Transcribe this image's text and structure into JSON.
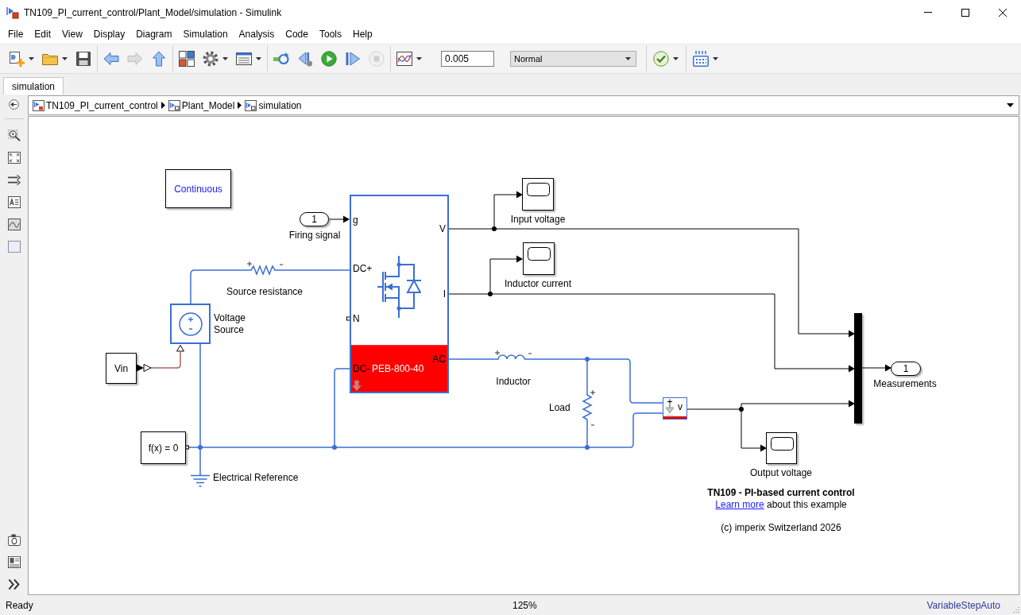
{
  "window": {
    "title": "TN109_PI_current_control/Plant_Model/simulation - Simulink"
  },
  "menu": [
    "File",
    "Edit",
    "View",
    "Display",
    "Diagram",
    "Simulation",
    "Analysis",
    "Code",
    "Tools",
    "Help"
  ],
  "toolbar": {
    "left_groups": [
      [
        {
          "dropdown": true,
          "disabled": false
        },
        {
          "dropdown": true,
          "disabled": false
        },
        {
          "dropdown": false,
          "disabled": false
        }
      ],
      [
        {
          "dropdown": false,
          "disabled": false
        },
        {
          "dropdown": false,
          "disabled": true
        },
        {
          "dropdown": false,
          "disabled": false
        }
      ],
      [
        {
          "dropdown": false,
          "disabled": false
        },
        {
          "dropdown": true,
          "disabled": false
        },
        {
          "dropdown": true,
          "disabled": false
        }
      ],
      [
        {
          "dropdown": false,
          "disabled": false
        },
        {
          "dropdown": false,
          "disabled": false
        },
        {
          "dropdown": false,
          "disabled": false
        },
        {
          "dropdown": false,
          "disabled": false
        },
        {
          "dropdown": false,
          "disabled": true
        }
      ],
      [
        {
          "dropdown": true,
          "disabled": false
        }
      ]
    ],
    "stop_time": "0.005",
    "mode": "Normal",
    "right_groups": [
      [
        {
          "dropdown": true,
          "disabled": false
        }
      ],
      [
        {
          "dropdown": true,
          "disabled": false
        }
      ]
    ]
  },
  "tabs": [
    {
      "label": "simulation",
      "selected": true
    }
  ],
  "breadcrumb": [
    {
      "kind": "model",
      "label": "TN109_PI_current_control"
    },
    {
      "kind": "subsystem",
      "label": "Plant_Model"
    },
    {
      "kind": "subsystem",
      "label": "simulation"
    }
  ],
  "diagram": {
    "solver": {
      "text": "Continuous"
    },
    "firing_signal": {
      "port": "1",
      "label": "Firing signal"
    },
    "source_resistance": {
      "label": "Source resistance"
    },
    "voltage_source": {
      "label": "Voltage Source"
    },
    "vin": {
      "text": "Vin"
    },
    "solver_configuration": {
      "text": "f(x) = 0"
    },
    "electrical_reference": {
      "label": "Electrical Reference"
    },
    "converter": {
      "left_ports": [
        "g",
        "DC+",
        "N",
        "DC-"
      ],
      "right_ports": [
        "V",
        "I",
        "AC"
      ],
      "model": "PEB-800-40"
    },
    "input_scope": {
      "label": "Input voltage"
    },
    "current_scope": {
      "label": "Inductor current"
    },
    "inductor": {
      "label": "Inductor"
    },
    "load": {
      "label": "Load"
    },
    "voltage_sensor": {
      "port": "v"
    },
    "measurements": {
      "port": "1",
      "label": "Measurements"
    },
    "output_scope": {
      "label": "Output voltage"
    },
    "annotation": {
      "title": "TN109 - PI-based current control",
      "link": "Learn more",
      "text": "about this example",
      "copyright": "(c) imperix Switzerland 2026"
    }
  },
  "status_bar": {
    "state": "Ready",
    "zoom": "125%",
    "solver": "VariableStepAuto"
  }
}
